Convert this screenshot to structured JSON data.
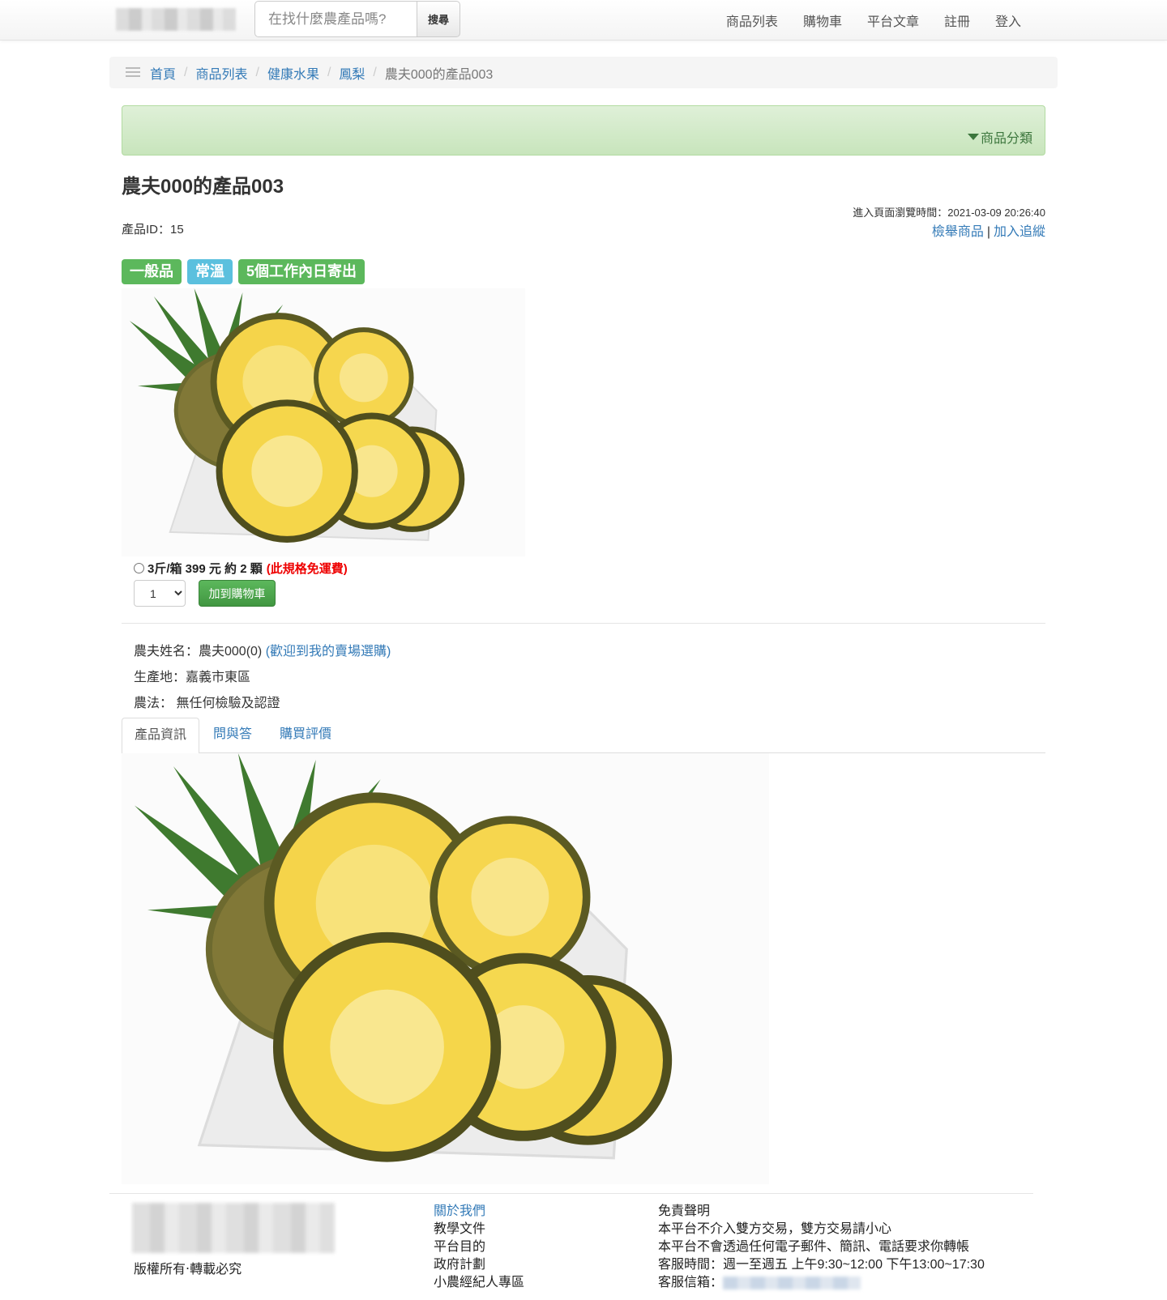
{
  "header": {
    "search": {
      "placeholder": "在找什麼農產品嗎?",
      "button_label": "搜尋"
    },
    "nav": [
      "商品列表",
      "購物車",
      "平台文章",
      "註冊",
      "登入"
    ]
  },
  "breadcrumb": {
    "items": [
      "首頁",
      "商品列表",
      "健康水果",
      "鳳梨"
    ],
    "current": "農夫000的產品003",
    "separator": "/"
  },
  "category_panel": {
    "toggle_label": "商品分類"
  },
  "product": {
    "title": "農夫000的產品003",
    "id_label": "產品ID：15",
    "browse_time": "進入頁面瀏覽時間：2021-03-09 20:26:40",
    "report_label": "檢舉商品",
    "separator": "|",
    "follow_label": "加入追縱",
    "badges": [
      "一般品",
      "常溫",
      "5個工作內日寄出"
    ],
    "spec": {
      "text": "3斤/箱 399 元 約 2 顆",
      "note": "(此規格免運費)"
    },
    "quantity": "1",
    "add_to_cart_label": "加到購物車",
    "farmer_label": "農夫姓名：農夫000(0)",
    "farmer_link": "(歡迎到我的賣場選購)",
    "origin": "生產地：嘉義市東區",
    "method": "農法： 無任何檢驗及認證",
    "tabs": [
      "產品資訊",
      "問與答",
      "購買評價"
    ]
  },
  "footer": {
    "copyright": "版權所有‧轉載必究",
    "links": [
      "關於我們",
      "教學文件",
      "平台目的",
      "政府計劃",
      "小農經紀人專區"
    ],
    "disclaimer_title": "免責聲明",
    "disclaimer": [
      "本平台不介入雙方交易，雙方交易請小心",
      "本平台不會透過任何電子郵件、簡訊、電話要求你轉帳",
      "客服時間：週一至週五 上午9:30~12:00 下午13:00~17:30"
    ],
    "email_label": "客服信箱："
  },
  "colors": {
    "link": "#337ab7",
    "success": "#5cb85c",
    "info": "#5bc0de",
    "danger": "#ee0000",
    "panel": "#dff0d8"
  }
}
